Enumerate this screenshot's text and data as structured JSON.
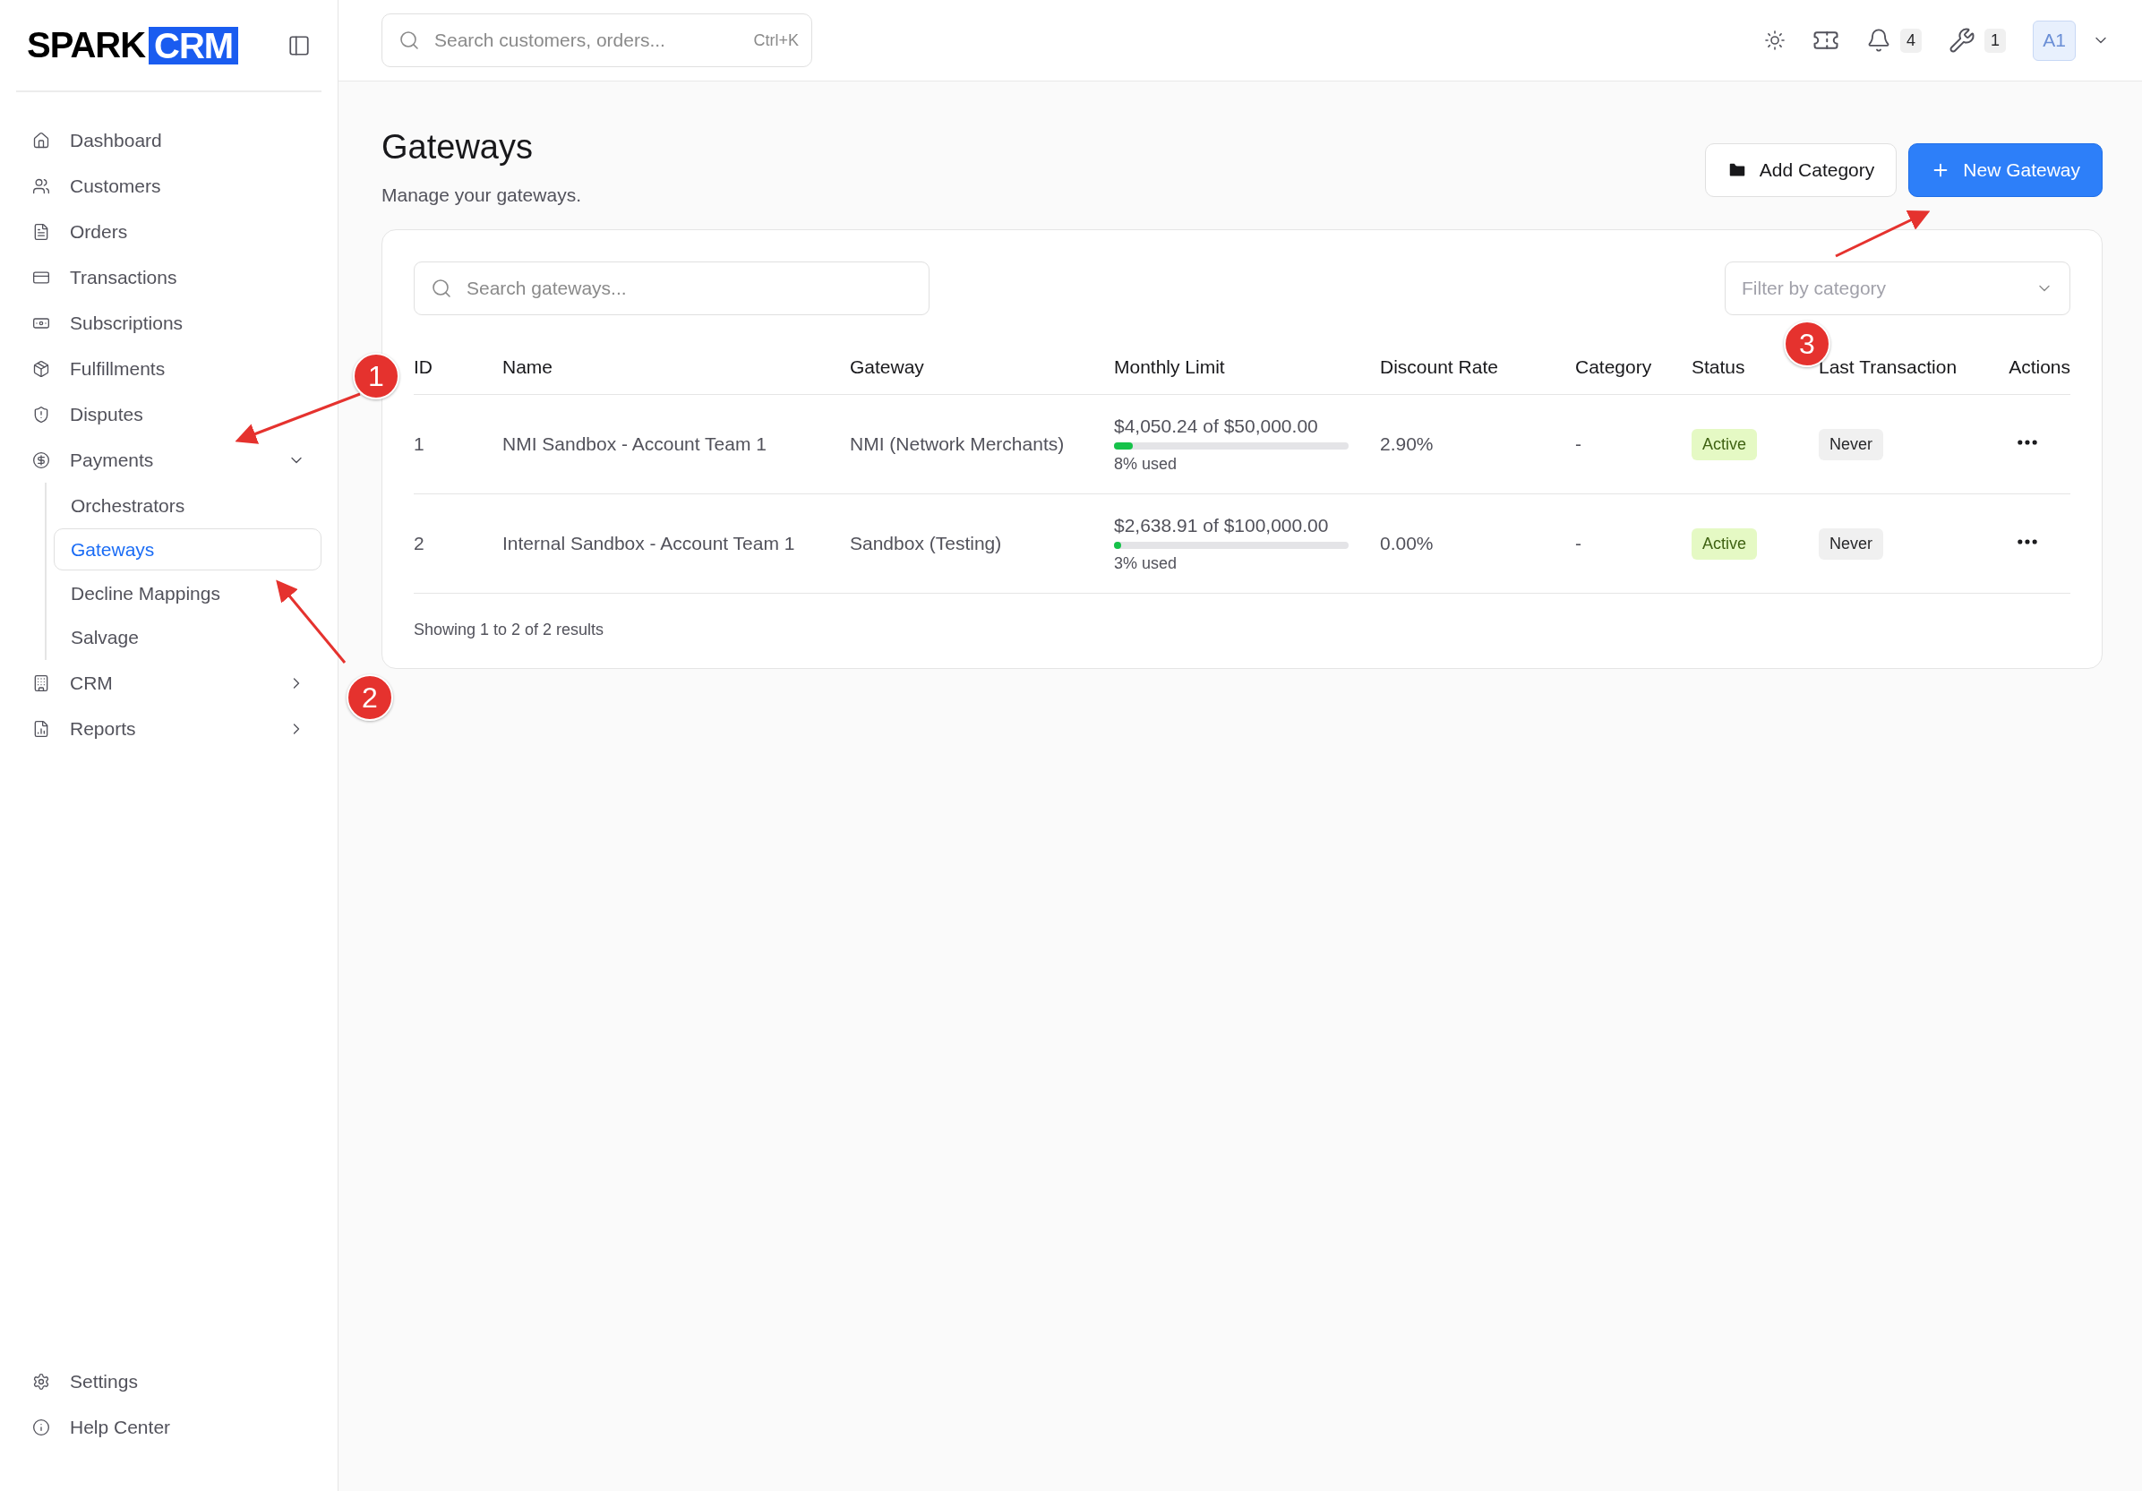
{
  "sidebar": {
    "logo": {
      "text": "SPARK",
      "highlight": "CRM"
    },
    "nav": [
      {
        "label": "Dashboard",
        "selected": false
      },
      {
        "label": "Customers",
        "selected": false
      },
      {
        "label": "Orders",
        "selected": false
      },
      {
        "label": "Transactions",
        "selected": false
      },
      {
        "label": "Subscriptions",
        "selected": false
      },
      {
        "label": "Fulfillments",
        "selected": false
      },
      {
        "label": "Disputes",
        "selected": false
      },
      {
        "label": "Payments",
        "selected": false,
        "expanded": true,
        "children": [
          {
            "label": "Orchestrators",
            "selected": false
          },
          {
            "label": "Gateways",
            "selected": true
          },
          {
            "label": "Decline Mappings",
            "selected": false
          },
          {
            "label": "Salvage",
            "selected": false
          }
        ]
      },
      {
        "label": "CRM",
        "selected": false,
        "expanded": false
      },
      {
        "label": "Reports",
        "selected": false,
        "expanded": false
      }
    ],
    "footer": [
      {
        "label": "Settings"
      },
      {
        "label": "Help Center"
      }
    ]
  },
  "topbar": {
    "search": {
      "placeholder": "Search customers, orders...",
      "shortcut": "Ctrl+K"
    },
    "notifications": "4",
    "tools": "1",
    "avatar": "A1"
  },
  "page": {
    "title": "Gateways",
    "subtitle": "Manage your gateways.",
    "buttons": [
      {
        "label": "Add Category",
        "kind": "secondary"
      },
      {
        "label": "New Gateway",
        "kind": "primary"
      }
    ]
  },
  "table": {
    "search": {
      "placeholder": "Search gateways..."
    },
    "filter": {
      "placeholder": "Filter by category"
    },
    "columns": [
      "ID",
      "Name",
      "Gateway",
      "Monthly Limit",
      "Discount Rate",
      "Category",
      "Status",
      "Last Transaction",
      "Actions"
    ],
    "rows": [
      {
        "id": "1",
        "name": "NMI Sandbox - Account Team 1",
        "gateway": "NMI (Network Merchants)",
        "limit": {
          "used": "$4,050.24",
          "of": "of",
          "total": "$50,000.00",
          "level": 0.08,
          "note": "8% used"
        },
        "discount": "2.90%",
        "category": "-",
        "status": {
          "label": "Active",
          "kind": "active"
        },
        "last_transaction": "Never"
      },
      {
        "id": "2",
        "name": "Internal Sandbox - Account Team 1",
        "gateway": "Sandbox (Testing)",
        "limit": {
          "used": "$2,638.91",
          "of": "of",
          "total": "$100,000.00",
          "level": 0.03,
          "note": "3% used"
        },
        "discount": "0.00%",
        "category": "-",
        "status": {
          "label": "Active",
          "kind": "active"
        },
        "last_transaction": "Never"
      }
    ],
    "footer": "Showing 1 to 2 of 2 results"
  },
  "annotations": [
    {
      "label": "1"
    },
    {
      "label": "2"
    },
    {
      "label": "3"
    }
  ]
}
